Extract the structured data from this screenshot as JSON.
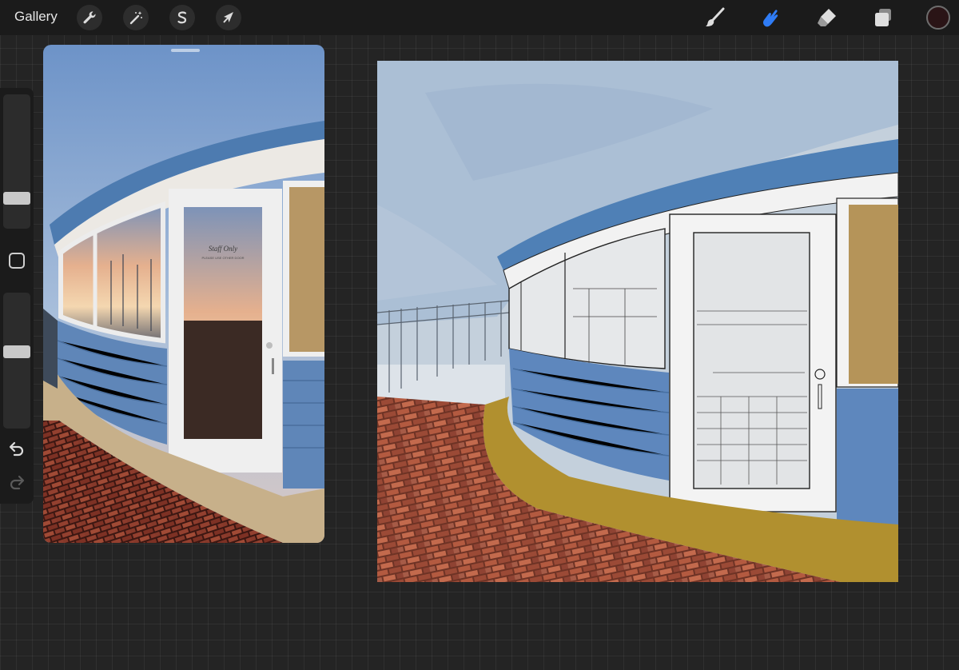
{
  "toolbar": {
    "gallery_label": "Gallery",
    "left_tools": [
      {
        "name": "actions",
        "icon": "wrench-icon"
      },
      {
        "name": "adjustments",
        "icon": "magic-wand-icon"
      },
      {
        "name": "selection",
        "icon": "selection-s-icon"
      },
      {
        "name": "transform",
        "icon": "arrow-cursor-icon"
      }
    ],
    "right_tools": [
      {
        "name": "brush",
        "icon": "brush-icon",
        "active": false
      },
      {
        "name": "smudge",
        "icon": "smudge-finger-icon",
        "active": true
      },
      {
        "name": "eraser",
        "icon": "eraser-icon",
        "active": false
      },
      {
        "name": "layers",
        "icon": "layers-icon",
        "active": false
      }
    ],
    "active_tool_color": "#2f7cf6",
    "current_color": "#2a1416"
  },
  "sidebar": {
    "brush_size_level": 0.25,
    "opacity_level": 0.45,
    "modify_icon": "square-icon",
    "undo_icon": "undo-icon",
    "redo_icon": "redo-icon"
  },
  "reference": {
    "door_sign_line1": "Staff Only",
    "door_sign_line2": "PLEASE USE OTHER DOOR"
  },
  "colors": {
    "wall_blue": "#5f86b8",
    "brick": "#8e3f2e",
    "sky_painted": "#b8c8da",
    "curb_ochre": "#b1902f"
  }
}
